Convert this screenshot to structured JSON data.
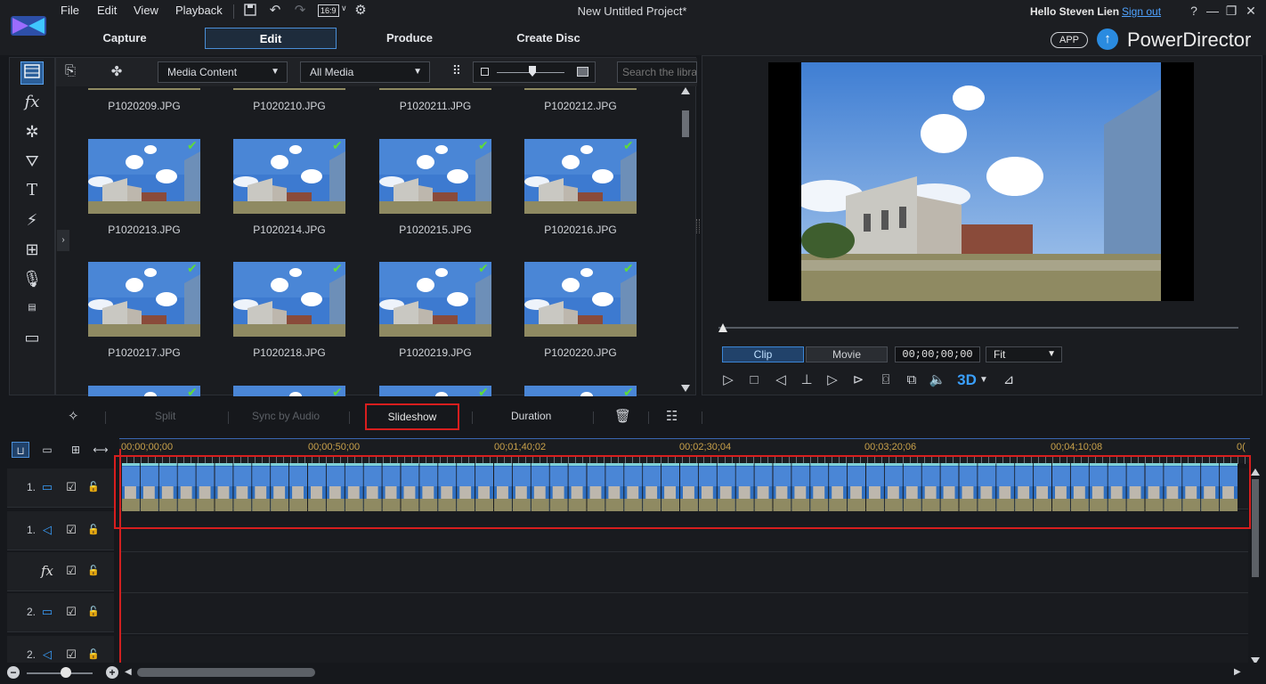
{
  "menu": [
    "File",
    "Edit",
    "View",
    "Playback"
  ],
  "aspect_ratio": "16:9",
  "project_title": "New Untitled Project*",
  "user": {
    "greeting": "Hello Steven Lien",
    "signout": "Sign out"
  },
  "modes": [
    "Capture",
    "Edit",
    "Produce",
    "Create Disc"
  ],
  "app_badge": "APP",
  "brand": "PowerDirector",
  "library": {
    "media_dropdown": "Media Content",
    "filter_dropdown": "All Media",
    "search_placeholder": "Search the library",
    "rows": [
      [
        "P1020209.JPG",
        "P1020210.JPG",
        "P1020211.JPG",
        "P1020212.JPG"
      ],
      [
        "P1020213.JPG",
        "P1020214.JPG",
        "P1020215.JPG",
        "P1020216.JPG"
      ],
      [
        "P1020217.JPG",
        "P1020218.JPG",
        "P1020219.JPG",
        "P1020220.JPG"
      ]
    ]
  },
  "preview": {
    "clip_label": "Clip",
    "movie_label": "Movie",
    "timecode": "00;00;00;00",
    "fit": "Fit",
    "btn_3d": "3D"
  },
  "edit_toolbar": {
    "split": "Split",
    "sync_audio": "Sync by Audio",
    "slideshow": "Slideshow",
    "duration": "Duration"
  },
  "ruler": [
    "00;00;00;00",
    "00;00;50;00",
    "00;01;40;02",
    "00;02;30;04",
    "00;03;20;06",
    "00;04;10;08",
    "0("
  ],
  "tracks": [
    "1.",
    "1.",
    "",
    "2.",
    "2."
  ],
  "colors": {
    "accent": "#2b5f9a",
    "highlight": "#d81e1e",
    "check": "#5edb3a"
  }
}
